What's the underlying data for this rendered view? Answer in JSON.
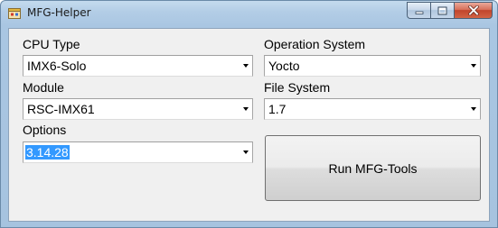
{
  "window": {
    "title": "MFG-Helper"
  },
  "form": {
    "cpu_type": {
      "label": "CPU Type",
      "value": "IMX6-Solo"
    },
    "module": {
      "label": "Module",
      "value": "RSC-IMX61"
    },
    "options": {
      "label": "Options",
      "value": "3.14.28"
    },
    "operation_system": {
      "label": "Operation System",
      "value": "Yocto"
    },
    "file_system": {
      "label": "File System",
      "value": "1.7"
    },
    "run_button": "Run MFG-Tools"
  },
  "icons": {
    "app": "app-window-icon",
    "minimize": "minimize-icon",
    "maximize": "maximize-icon",
    "close": "close-icon",
    "dropdown": "chevron-down-icon"
  },
  "colors": {
    "selection": "#3399ff",
    "close_button": "#c7452d",
    "frame": "#a9c6e2"
  }
}
